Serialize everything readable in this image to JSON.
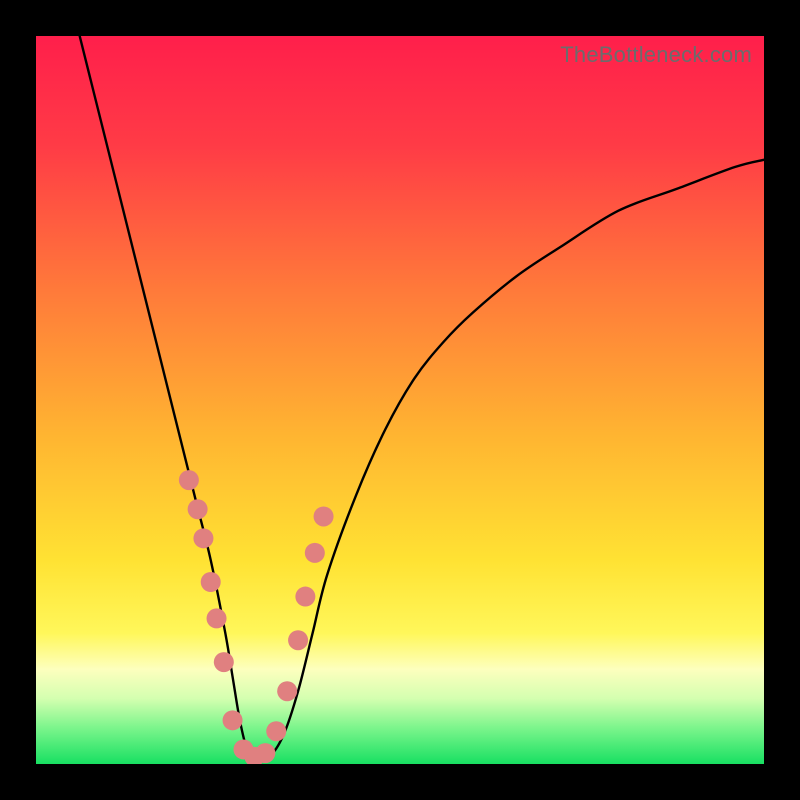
{
  "watermark": "TheBottleneck.com",
  "chart_data": {
    "type": "line",
    "title": "",
    "xlabel": "",
    "ylabel": "",
    "xlim": [
      0,
      100
    ],
    "ylim": [
      0,
      100
    ],
    "series": [
      {
        "name": "bottleneck-curve",
        "x": [
          6,
          8,
          10,
          12,
          14,
          16,
          18,
          20,
          22,
          24,
          26,
          27,
          28,
          29,
          30,
          32,
          34,
          36,
          38,
          40,
          44,
          48,
          52,
          56,
          60,
          66,
          72,
          80,
          88,
          96,
          100
        ],
        "values": [
          100,
          92,
          84,
          76,
          68,
          60,
          52,
          44,
          36,
          28,
          18,
          12,
          6,
          2,
          1,
          1,
          4,
          10,
          18,
          26,
          37,
          46,
          53,
          58,
          62,
          67,
          71,
          76,
          79,
          82,
          83
        ]
      }
    ],
    "markers": {
      "name": "highlight-dots",
      "x": [
        21.0,
        22.2,
        23.0,
        24.0,
        24.8,
        25.8,
        27.0,
        28.5,
        30.0,
        31.5,
        33.0,
        34.5,
        36.0,
        37.0,
        38.3,
        39.5
      ],
      "values": [
        39.0,
        35.0,
        31.0,
        25.0,
        20.0,
        14.0,
        6.0,
        2.0,
        1.0,
        1.5,
        4.5,
        10.0,
        17.0,
        23.0,
        29.0,
        34.0
      ],
      "r": 10
    },
    "background_gradient": {
      "stops": [
        {
          "offset": 0.0,
          "color": "#ff1f4b"
        },
        {
          "offset": 0.15,
          "color": "#ff3b46"
        },
        {
          "offset": 0.35,
          "color": "#ff7a3a"
        },
        {
          "offset": 0.55,
          "color": "#ffb531"
        },
        {
          "offset": 0.72,
          "color": "#ffe233"
        },
        {
          "offset": 0.82,
          "color": "#fff75a"
        },
        {
          "offset": 0.87,
          "color": "#fdffbe"
        },
        {
          "offset": 0.91,
          "color": "#d4ffb0"
        },
        {
          "offset": 0.95,
          "color": "#7cf58c"
        },
        {
          "offset": 1.0,
          "color": "#18e062"
        }
      ]
    }
  }
}
